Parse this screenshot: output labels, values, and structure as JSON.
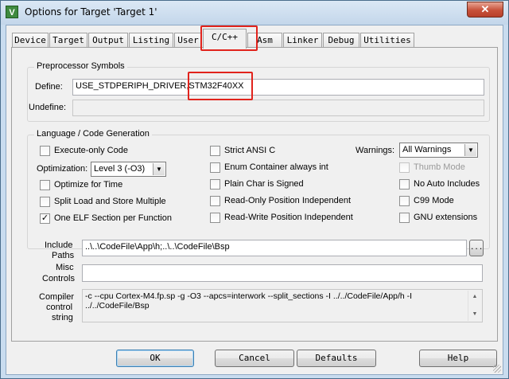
{
  "window": {
    "title": "Options for Target 'Target 1'",
    "close_glyph": "✕",
    "app_icon_glyph": "V"
  },
  "tabs": [
    {
      "label": "Device"
    },
    {
      "label": "Target"
    },
    {
      "label": "Output"
    },
    {
      "label": "Listing"
    },
    {
      "label": "User"
    },
    {
      "label": "C/C++"
    },
    {
      "label": "Asm"
    },
    {
      "label": "Linker"
    },
    {
      "label": "Debug"
    },
    {
      "label": "Utilities"
    }
  ],
  "active_tab": "C/C++",
  "preprocessor": {
    "legend": "Preprocessor Symbols",
    "define_label": "Define:",
    "define_value": "USE_STDPERIPH_DRIVER,STM32F40XX",
    "undefine_label": "Undefine:",
    "undefine_value": ""
  },
  "language": {
    "legend": "Language / Code Generation",
    "execute_only": {
      "label": "Execute-only Code",
      "checked": false
    },
    "optimization_label": "Optimization:",
    "optimization_value": "Level 3 (-O3)",
    "optimize_time": {
      "label": "Optimize for Time",
      "checked": false
    },
    "split_load": {
      "label": "Split Load and Store Multiple",
      "checked": false
    },
    "one_elf": {
      "label": "One ELF Section per Function",
      "checked": true
    },
    "strict_ansi": {
      "label": "Strict ANSI C",
      "checked": false
    },
    "enum_container": {
      "label": "Enum Container always int",
      "checked": false
    },
    "plain_char": {
      "label": "Plain Char is Signed",
      "checked": false
    },
    "ro_pi": {
      "label": "Read-Only Position Independent",
      "checked": false
    },
    "rw_pi": {
      "label": "Read-Write Position Independent",
      "checked": false
    },
    "warnings_label": "Warnings:",
    "warnings_value": "All Warnings",
    "thumb_mode": {
      "label": "Thumb Mode",
      "checked": false,
      "enabled": false
    },
    "no_auto_includes": {
      "label": "No Auto Includes",
      "checked": false
    },
    "c99_mode": {
      "label": "C99 Mode",
      "checked": false
    },
    "gnu_extensions": {
      "label": "GNU extensions",
      "checked": false
    }
  },
  "include_paths": {
    "label_line1": "Include",
    "label_line2": "Paths",
    "value": "..\\..\\CodeFile\\App\\h;..\\..\\CodeFile\\Bsp",
    "browse_label": "..."
  },
  "misc_controls": {
    "label_line1": "Misc",
    "label_line2": "Controls",
    "value": ""
  },
  "compiler_control": {
    "label_line1": "Compiler",
    "label_line2": "control",
    "label_line3": "string",
    "line1": "-c --cpu Cortex-M4.fp.sp -g -O3 --apcs=interwork --split_sections -I ../../CodeFile/App/h -I",
    "line2": "../../CodeFile/Bsp"
  },
  "buttons": {
    "ok": "OK",
    "cancel": "Cancel",
    "defaults": "Defaults",
    "help": "Help"
  },
  "colors": {
    "highlight": "#e1231c",
    "window_frame": "#c9dcef",
    "dialog_bg": "#f0f0f0"
  },
  "check_glyph": "✓",
  "dropdown_glyph": "▼",
  "scroll_up_glyph": "▲",
  "scroll_down_glyph": "▼"
}
